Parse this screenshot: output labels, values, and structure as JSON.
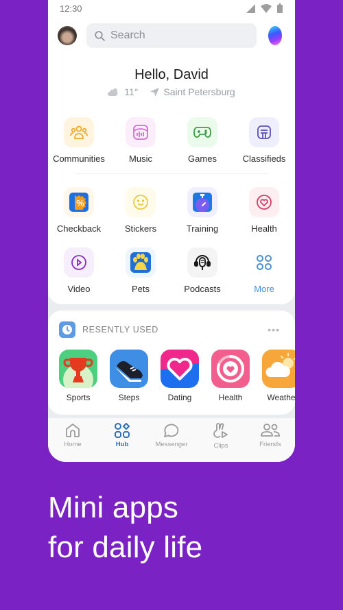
{
  "status_bar": {
    "time": "12:30"
  },
  "search": {
    "placeholder": "Search"
  },
  "greeting": "Hello, David",
  "weather": {
    "temperature": "11°",
    "location": "Saint Petersburg"
  },
  "services": [
    {
      "label": "Communities",
      "icon": "communities-icon",
      "tile_color": "#fff4e0",
      "icon_color": "#f0a92a"
    },
    {
      "label": "Music",
      "icon": "music-icon",
      "tile_color": "#fcedfb",
      "icon_color": "#d46ad6"
    },
    {
      "label": "Games",
      "icon": "games-icon",
      "tile_color": "#eafaeb",
      "icon_color": "#3f9c47"
    },
    {
      "label": "Classifieds",
      "icon": "classifieds-icon",
      "tile_color": "#efeefc",
      "icon_color": "#5a4fb8"
    },
    {
      "label": "Checkback",
      "icon": "checkback-icon",
      "tile_color": "#fff8ea",
      "icon_color": "#f28c1a"
    },
    {
      "label": "Stickers",
      "icon": "stickers-icon",
      "tile_color": "#fffbea",
      "icon_color": "#ecc93a"
    },
    {
      "label": "Training",
      "icon": "training-icon",
      "tile_color": "#f1effd",
      "icon_color": "#7b5cf0"
    },
    {
      "label": "Health",
      "icon": "health-icon",
      "tile_color": "#fdeef2",
      "icon_color": "#d23c66"
    },
    {
      "label": "Video",
      "icon": "video-icon",
      "tile_color": "#f6effb",
      "icon_color": "#8a2ac4"
    },
    {
      "label": "Pets",
      "icon": "pets-icon",
      "tile_color": "#eef5fd",
      "icon_color": "#1f6fd6"
    },
    {
      "label": "Podcasts",
      "icon": "podcasts-icon",
      "tile_color": "#f4f4f5",
      "icon_color": "#1a1a1a"
    },
    {
      "label": "More",
      "icon": "more-grid-icon",
      "tile_color": "#ffffff",
      "icon_color": "#4a8fd1"
    }
  ],
  "recently_used": {
    "title": "RESENTLY USED",
    "more": "•••",
    "items": [
      {
        "label": "Sports",
        "icon": "trophy-icon"
      },
      {
        "label": "Steps",
        "icon": "sneaker-icon"
      },
      {
        "label": "Dating",
        "icon": "heart-icon"
      },
      {
        "label": "Health",
        "icon": "health-ring-icon"
      },
      {
        "label": "Weathe",
        "icon": "weather-icon"
      }
    ]
  },
  "tabbar": {
    "tabs": [
      {
        "label": "Home",
        "active": false
      },
      {
        "label": "Hub",
        "active": true
      },
      {
        "label": "Messenger",
        "active": false
      },
      {
        "label": "Clips",
        "active": false
      },
      {
        "label": "Friends",
        "active": false
      }
    ]
  },
  "headline": {
    "line1": "Mini apps",
    "line2": "for daily life"
  },
  "colors": {
    "background": "#7b22c4",
    "accent": "#2d6fb8"
  }
}
